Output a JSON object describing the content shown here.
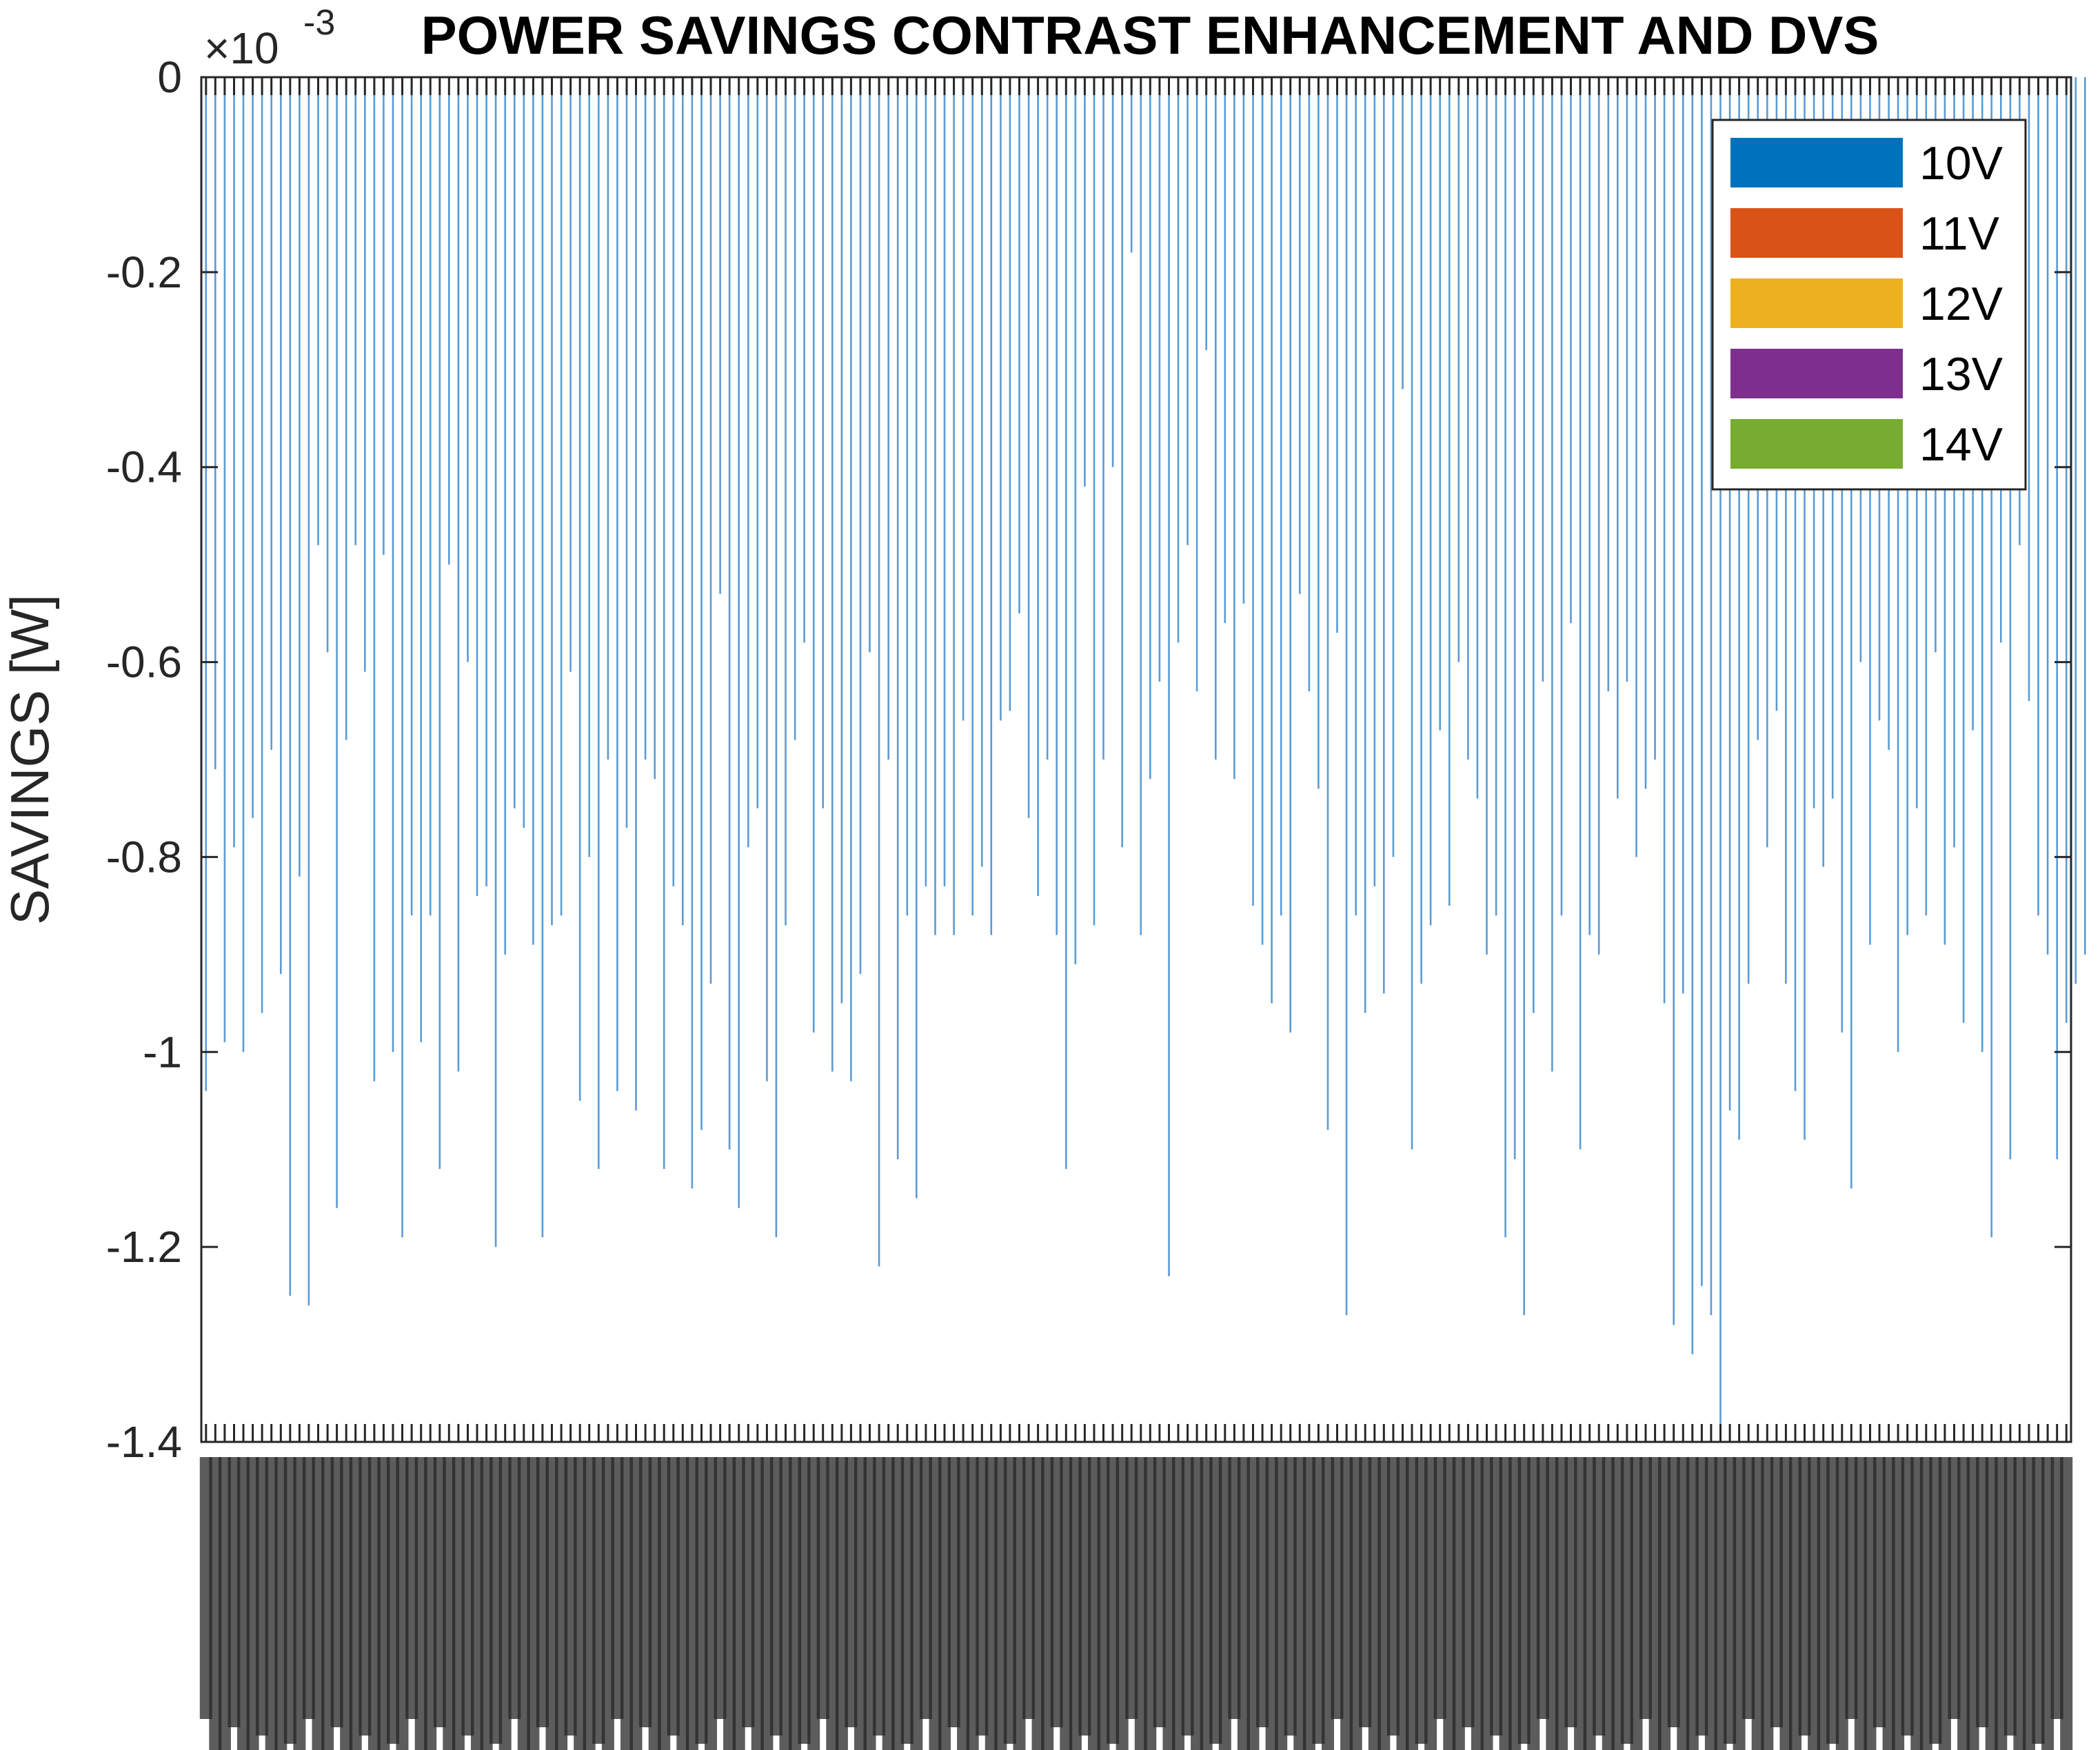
{
  "chart_data": {
    "type": "bar",
    "title": "POWER SAVINGS CONTRAST ENHANCEMENT AND DVS",
    "xlabel": "",
    "ylabel": "SAVINGS  [W]",
    "exponent_label": "×10",
    "exponent_power": "-3",
    "ylim": [
      -1.4,
      0
    ],
    "yticks": [
      0,
      -0.2,
      -0.4,
      -0.6,
      -0.8,
      -1,
      -1.2,
      -1.4
    ],
    "ytick_labels": [
      "0",
      "-0.2",
      "-0.4",
      "-0.6",
      "-0.8",
      "-1",
      "-1.2",
      "-1.4"
    ],
    "grid": false,
    "legend_position": "top-right",
    "legend": [
      {
        "name": "10V",
        "color": "#0072BD"
      },
      {
        "name": "11V",
        "color": "#D95319"
      },
      {
        "name": "12V",
        "color": "#EDB120"
      },
      {
        "name": "13V",
        "color": "#7E2F8E"
      },
      {
        "name": "14V",
        "color": "#77AC30"
      }
    ],
    "bar_color": "#5B9BD5",
    "category_count": 200,
    "series": [
      {
        "name": "10V",
        "values": [
          -1.04,
          -0.71,
          -0.99,
          -0.79,
          -1.0,
          -0.76,
          -0.96,
          -0.69,
          -0.92,
          -1.25,
          -0.82,
          -1.26,
          -0.48,
          -0.59,
          -1.16,
          -0.68,
          -0.48,
          -0.61,
          -1.03,
          -0.49,
          -1.0,
          -1.19,
          -0.86,
          -0.99,
          -0.86,
          -1.12,
          -0.5,
          -1.02,
          -0.6,
          -0.84,
          -0.83,
          -1.2,
          -0.9,
          -0.75,
          -0.77,
          -0.89,
          -1.19,
          -0.87,
          -0.86,
          -0.61,
          -1.05,
          -0.8,
          -1.12,
          -0.7,
          -1.04,
          -0.77,
          -1.06,
          -0.7,
          -0.72,
          -1.12,
          -0.83,
          -0.87,
          -1.14,
          -1.08,
          -0.93,
          -0.53,
          -1.1,
          -1.16,
          -0.79,
          -0.75,
          -1.03,
          -1.19,
          -0.87,
          -0.68,
          -0.58,
          -0.98,
          -0.75,
          -1.02,
          -0.95,
          -1.03,
          -0.92,
          -0.59,
          -1.22,
          -0.7,
          -1.11,
          -0.86,
          -1.15,
          -0.83,
          -0.88,
          -0.83,
          -0.88,
          -0.66,
          -0.86,
          -0.81,
          -0.88,
          -0.66,
          -0.65,
          -0.55,
          -0.76,
          -0.84,
          -0.7,
          -0.88,
          -1.12,
          -0.91,
          -0.42,
          -0.87,
          -0.7,
          -0.4,
          -0.79,
          -0.18,
          -0.88,
          -0.72,
          -0.62,
          -1.23,
          -0.58,
          -0.48,
          -0.63,
          -0.28,
          -0.7,
          -0.56,
          -0.72,
          -0.54,
          -0.85,
          -0.89,
          -0.95,
          -0.86,
          -0.98,
          -0.53,
          -0.63,
          -0.73,
          -1.08,
          -0.57,
          -1.27,
          -0.86,
          -0.96,
          -0.83,
          -0.94,
          -0.8,
          -0.32,
          -1.1,
          -0.93,
          -0.87,
          -0.67,
          -0.85,
          -0.6,
          -0.7,
          -0.74,
          -0.9,
          -0.86,
          -1.19,
          -1.11,
          -1.27,
          -0.96,
          -0.62,
          -1.02,
          -0.86,
          -0.56,
          -1.1,
          -0.88,
          -0.9,
          -0.63,
          -0.74,
          -0.62,
          -0.8,
          -0.73,
          -0.7,
          -0.95,
          -1.28,
          -0.94,
          -1.31,
          -1.24,
          -1.27,
          -1.4,
          -1.06,
          -1.09,
          -0.93,
          -0.68,
          -0.79,
          -0.65,
          -0.93,
          -1.04,
          -1.09,
          -0.75,
          -0.81,
          -0.74,
          -0.98,
          -1.14,
          -0.6,
          -0.89,
          -0.66,
          -0.69,
          -1.0,
          -0.88,
          -0.75,
          -0.86,
          -0.59,
          -0.89,
          -0.79,
          -0.97,
          -0.67,
          -1.0,
          -1.19,
          -0.58,
          -1.11,
          -0.48,
          -0.64,
          -0.86,
          -0.9,
          -1.11,
          -0.97,
          -0.93,
          -0.9
        ]
      }
    ]
  }
}
